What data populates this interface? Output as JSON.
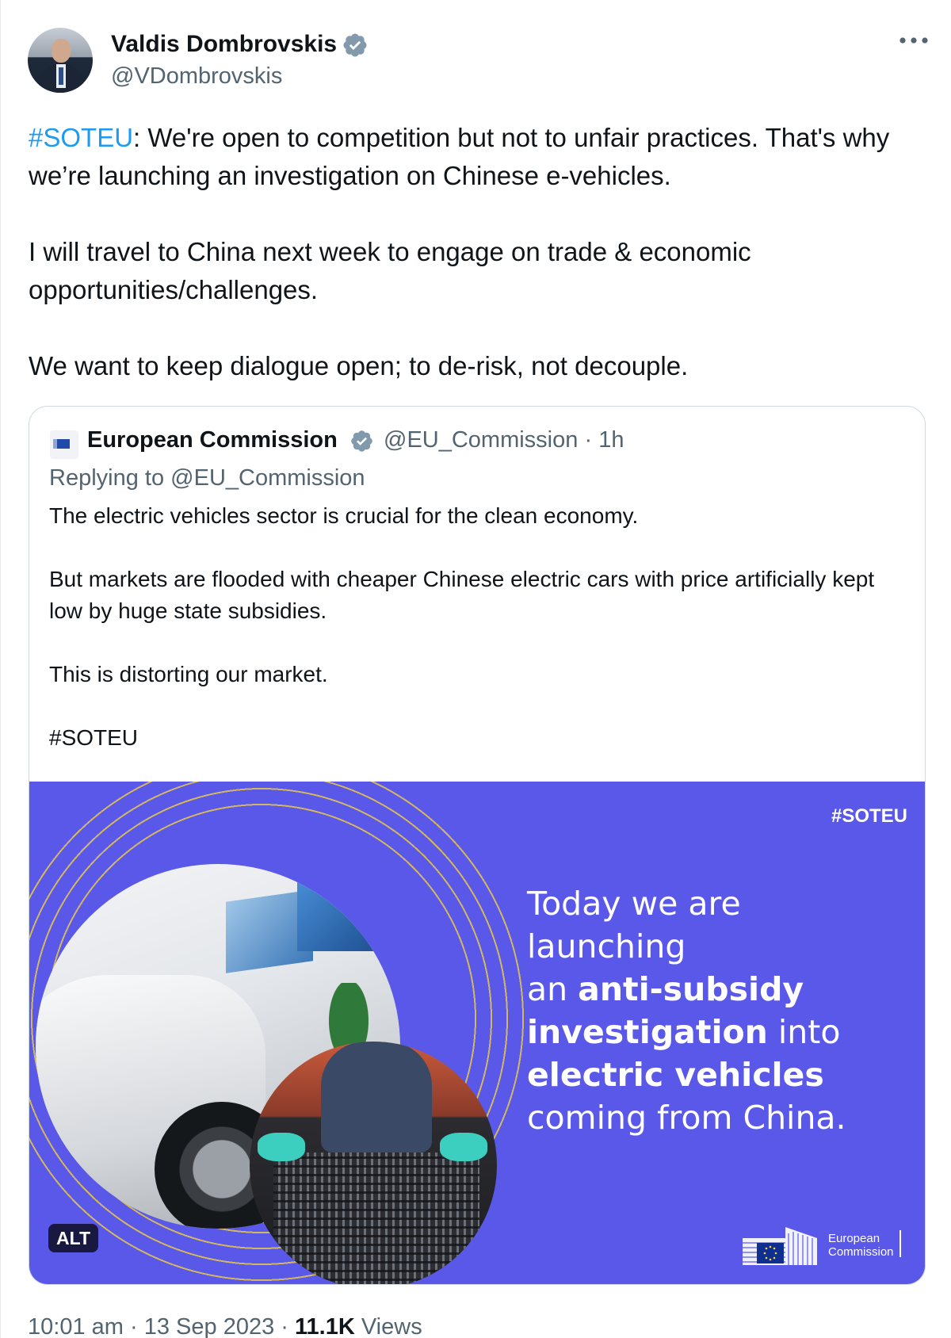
{
  "author": {
    "name": "Valdis Dombrovskis",
    "handle": "@VDombrovskis",
    "verified_icon": "verified-badge-icon",
    "more_icon": "more-options-icon"
  },
  "tweet": {
    "hashtag": "#SOTEU",
    "line1_rest": ": We're open to competition but not to unfair practices. That's why we’re launching an investigation on Chinese e-vehicles.",
    "para2": "I will travel to China next week to engage on trade & economic opportunities/challenges.",
    "para3": "We want to keep dialogue open; to de-risk, not decouple."
  },
  "quote": {
    "name": "European Commission",
    "handle": "@EU_Commission",
    "separator": "·",
    "time": "1h",
    "reply_prefix": "Replying to ",
    "reply_handle": "@EU_Commission",
    "para1": "The electric vehicles sector is crucial for the clean economy.",
    "para2": "But markets are flooded with cheaper Chinese electric cars with price artificially kept low by huge state subsidies.",
    "para3": "This is distorting our market.",
    "para4": "#SOTEU",
    "media": {
      "hashtag": "#SOTEU",
      "line1": "Today we are launching",
      "line2_pre": "an ",
      "line2_bold": "anti-subsidy",
      "line3_bold": "investigation",
      "line3_post": " into",
      "line4_bold": "electric vehicles",
      "line5": "coming from China.",
      "logo_line1": "European",
      "logo_line2": "Commission",
      "alt_badge": "ALT",
      "background_color": "#5a58e8",
      "ring_text_color": "#e8c74a"
    }
  },
  "footer": {
    "time": "10:01 am",
    "separator1": "·",
    "date": "13 Sep 2023",
    "separator2": "·",
    "views_count": "11.1K",
    "views_label": "Views"
  },
  "colors": {
    "hashtag": "#1d9bf0",
    "secondary_text": "#536471",
    "verified": "#829aab"
  }
}
